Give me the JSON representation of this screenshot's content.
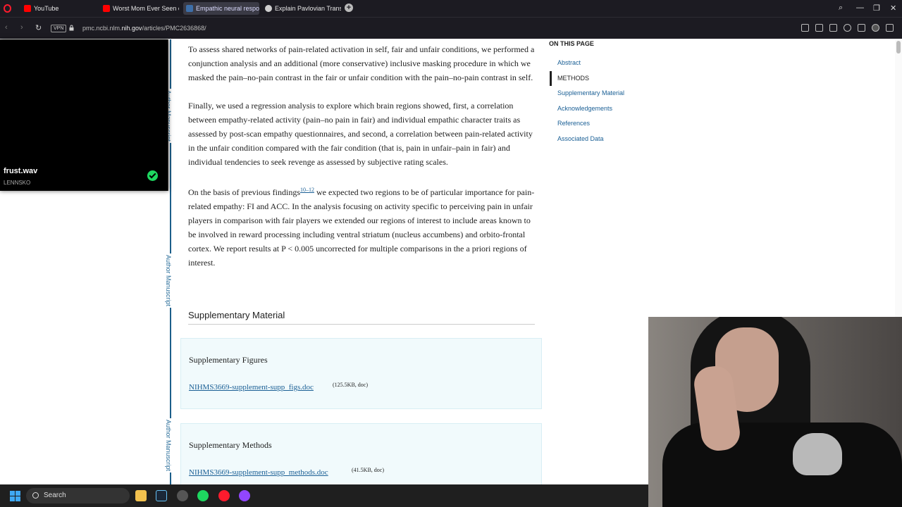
{
  "browser": {
    "tabs": [
      {
        "label": "YouTube",
        "active": false,
        "color": "#ff0000"
      },
      {
        "label": "Worst Mom Ever Seen on",
        "active": false,
        "color": "#ff0000"
      },
      {
        "label": "Empathic neural respons",
        "active": true,
        "color": "#3d6ea8"
      },
      {
        "label": "Explain Pavlovian Transfer",
        "active": false,
        "color": "#cfcfcf"
      }
    ],
    "vpn_label": "VPN",
    "url_prefix": "pmc.ncbi.nlm.",
    "url_domain": "nih.gov",
    "url_path": "/articles/PMC2636868/"
  },
  "now_playing": {
    "title": "frust.wav",
    "artist": "LENNSKO"
  },
  "rail_label": "Author Manuscript",
  "article": {
    "paragraphs": [
      "To assess shared networks of pain-related activation in self, fair and unfair conditions, we performed a conjunction analysis and an additional (more conservative) inclusive masking procedure in which we masked the pain–no-pain contrast in the fair or unfair condition with the pain–no-pain contrast in self.",
      "Finally, we used a regression analysis to explore which brain regions showed, first, a correlation between empathy-related activity (pain–no pain in fair) and individual empathic character traits as assessed by post-scan empathy questionnaires, and second, a correlation between pain-related activity in the unfair condition compared with the fair condition (that is, pain in unfair–pain in fair) and individual tendencies to seek revenge as assessed by subjective rating scales."
    ],
    "p3_before": "On the basis of previous findings",
    "p3_ref": "10–12",
    "p3_after": " we expected two regions to be of particular importance for pain-related empathy: FI and ACC. In the analysis focusing on activity specific to perceiving pain in unfair players in comparison with fair players we extended our regions of interest to include areas known to be involved in reward processing including ventral striatum (nucleus accumbens) and orbito-frontal cortex. We report results at P < 0.005 uncorrected for multiple comparisons in the a priori regions of interest.",
    "section_title": "Supplementary Material",
    "supplements": [
      {
        "heading": "Supplementary Figures",
        "file": "NIHMS3669-supplement-supp_figs.doc",
        "meta": "(125.5KB, doc)"
      },
      {
        "heading": "Supplementary Methods",
        "file": "NIHMS3669-supplement-supp_methods.doc",
        "meta": "(41.5KB, doc)"
      }
    ]
  },
  "toc": {
    "heading": "ON THIS PAGE",
    "items": [
      {
        "label": "Abstract",
        "active": false
      },
      {
        "label": "METHODS",
        "active": true
      },
      {
        "label": "Supplementary Material",
        "active": false
      },
      {
        "label": "Acknowledgements",
        "active": false
      },
      {
        "label": "References",
        "active": false
      },
      {
        "label": "Associated Data",
        "active": false
      }
    ]
  },
  "taskbar": {
    "search_label": "Search"
  }
}
